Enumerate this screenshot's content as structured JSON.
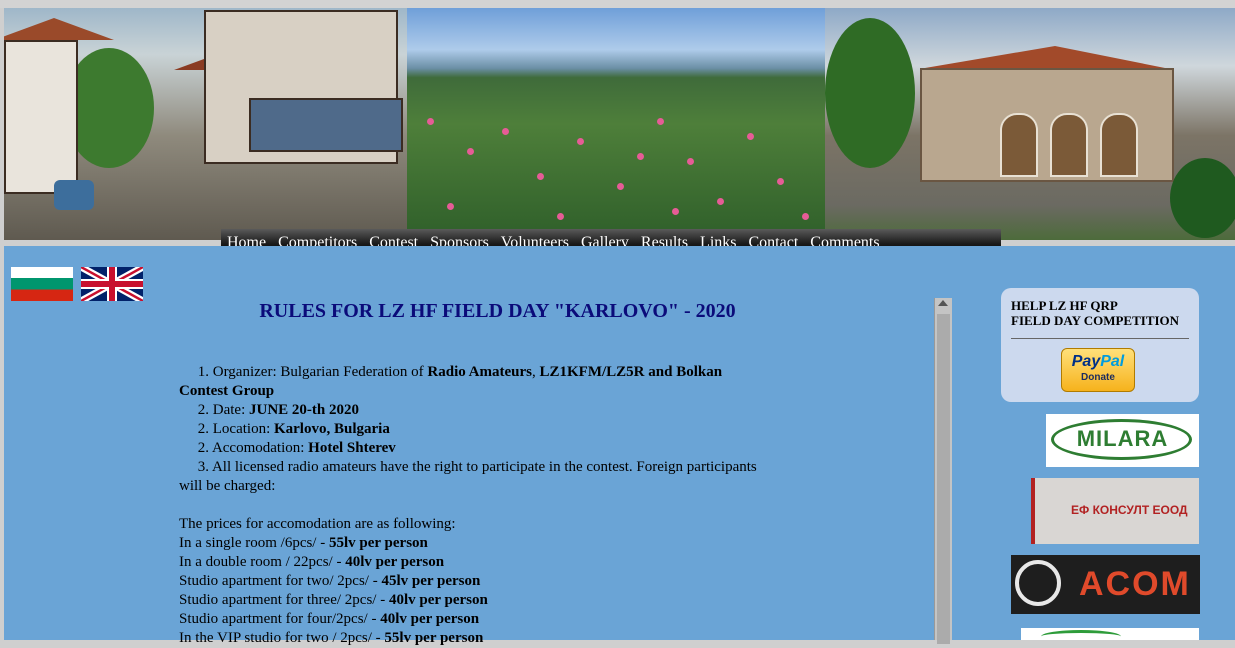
{
  "banner": {
    "images": [
      "karlovo-old-houses-photo",
      "rose-field-photo",
      "church-photo"
    ]
  },
  "nav": {
    "items": [
      "Home",
      "Competitors",
      "Contest",
      "Sponsors",
      "Volunteers",
      "Gallery",
      "Results",
      "Links",
      "Contact",
      "Comments"
    ]
  },
  "languages": [
    "bulgarian-flag",
    "uk-flag"
  ],
  "main": {
    "title": "RULES FOR LZ HF FIELD DAY \"KARLOVO\" - 2020",
    "rules": [
      {
        "num": "1.",
        "prefix": "Organizer: Bulgarian Federation of ",
        "bold": "Radio Amateurs",
        "mid": ", ",
        "bold2": "LZ1KFM/LZ5R and Bolkan",
        "cont": "Contest Group"
      },
      {
        "num": "2.",
        "prefix": "Date: ",
        "bold": "JUNE 20-th  2020"
      },
      {
        "num": "2.",
        "prefix": "Location: ",
        "bold": "Karlovo, Bulgaria"
      },
      {
        "num": "2.",
        "prefix": "Accomodation: ",
        "bold": "Hotel Shterev"
      },
      {
        "num": "3.",
        "prefix": "All licensed radio amateurs have the right to participate in the contest. Foreign participants",
        "cont": "will be charged:"
      }
    ],
    "prices_intro": "The prices for accomodation are as following:",
    "prices": [
      {
        "label": "In a single room /6pcs/ - ",
        "price": "55lv per person"
      },
      {
        "label": "In a double room / 22pcs/ - ",
        "price": "40lv per person"
      },
      {
        "label": "Studio apartment for two/ 2pcs/ - ",
        "price": "45lv per person"
      },
      {
        "label": "Studio apartment for three/ 2pcs/ - ",
        "price": "40lv per person"
      },
      {
        "label": "Studio apartment for four/2pcs/ - ",
        "price": "40lv per person"
      },
      {
        "label": "In the VIP studio for two / 2pcs/ - ",
        "price": "55lv per person"
      }
    ]
  },
  "sidebar": {
    "help_line1": "HELP LZ HF QRP",
    "help_line2": "FIELD DAY COMPETITION",
    "paypal_pay": "Pay",
    "paypal_pal": "Pal",
    "paypal_donate": "Donate",
    "sponsors": {
      "milara": "MILARA",
      "efk": "ЕФ КОНСУЛТ ЕООД",
      "acom": "ACOM"
    }
  }
}
